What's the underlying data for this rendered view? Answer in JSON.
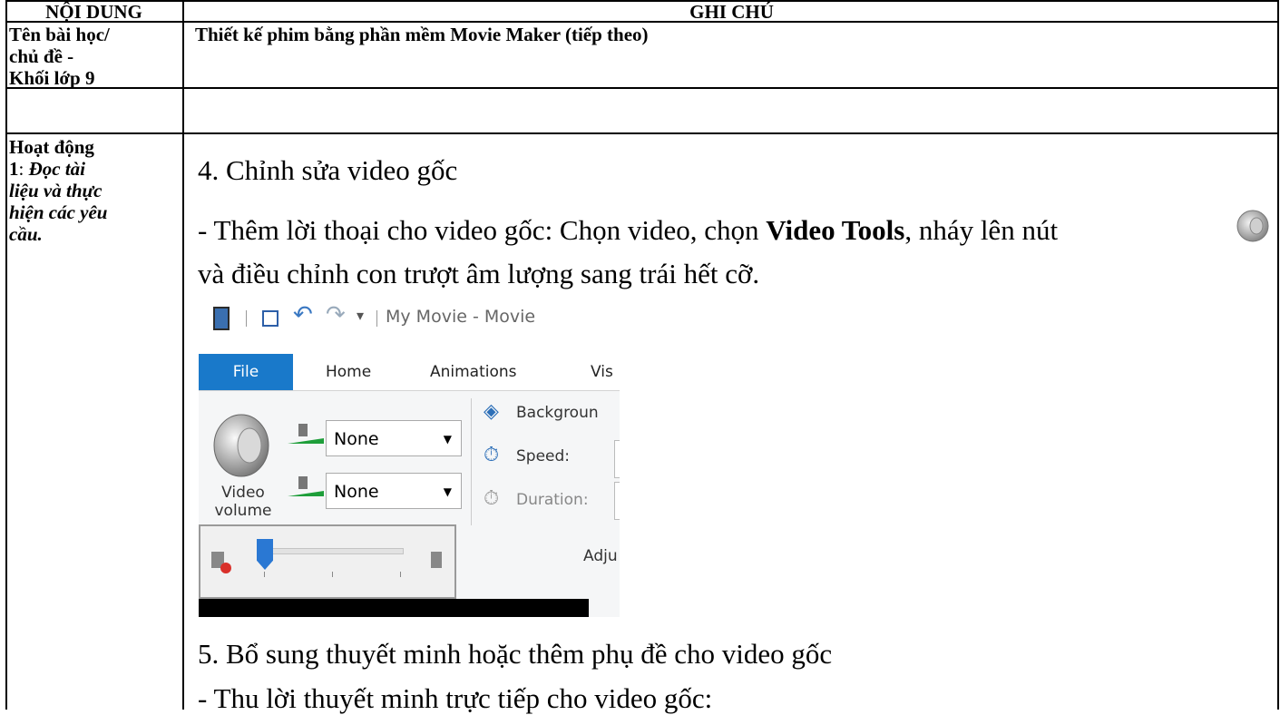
{
  "header": {
    "col1": "NỘI DUNG",
    "col2": "GHI CHÚ"
  },
  "row1": {
    "label_lines": [
      "Tên bài học/",
      "chủ đề -",
      "Khối lớp 9"
    ],
    "content": "Thiết kế phim bằng phần mềm Movie Maker (tiếp theo)"
  },
  "row2": {
    "label_bold": "Hoạt động",
    "label_num": "1",
    "label_colon": ":",
    "label_italic_lines": [
      " Đọc tài",
      "liệu và thực",
      "hiện các yêu",
      "cầu."
    ],
    "step4_title": "4. Chỉnh sửa video gốc",
    "step4_line1_pre": "- Thêm lời thoại cho video gốc: Chọn video, chọn ",
    "step4_line1_bold": "Video Tools",
    "step4_line1_post": ", nháy lên nút",
    "step4_line2": "và điều chỉnh con trượt âm lượng sang trái hết cỡ.",
    "step5_title": "5. Bổ sung thuyết minh hoặc thêm phụ đề cho video gốc",
    "step5_line1": "- Thu lời thuyết minh trực tiếp cho video gốc:"
  },
  "screenshot": {
    "window_title": "My Movie - Movie",
    "tabs": [
      "File",
      "Home",
      "Animations",
      "Vis"
    ],
    "dropdown1": "None",
    "dropdown2": "None",
    "video_volume_line1": "Video",
    "video_volume_line2": "volume",
    "background": "Backgroun",
    "speed": "Speed:",
    "duration": "Duration:",
    "group_label": "Adju",
    "accent_color": "#1979ca"
  }
}
